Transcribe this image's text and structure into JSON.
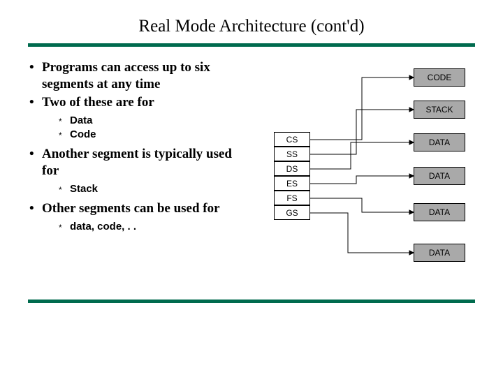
{
  "title": "Real Mode Architecture (cont'd)",
  "bullets": {
    "b1": "Programs can access up to six segments at any time",
    "b2": "Two of these are for",
    "b2_sub": {
      "s1": "Data",
      "s2": "Code"
    },
    "b3": "Another segment is typically used for",
    "b3_sub": {
      "s1": "Stack"
    },
    "b4": "Other segments can be used for",
    "b4_sub": {
      "s1": "data, code, . ."
    }
  },
  "registers": {
    "cs": "CS",
    "ss": "SS",
    "ds": "DS",
    "es": "ES",
    "fs": "FS",
    "gs": "GS"
  },
  "memory": {
    "code": "CODE",
    "stack": "STACK",
    "data1": "DATA",
    "data2": "DATA",
    "data3": "DATA",
    "data4": "DATA"
  }
}
